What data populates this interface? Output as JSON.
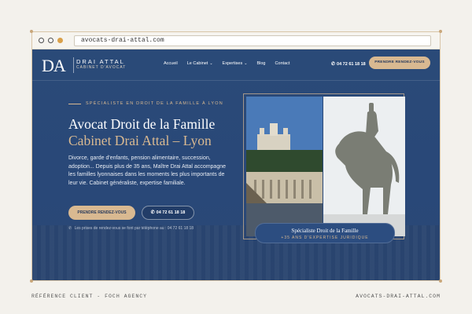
{
  "browser": {
    "url": "avocats-drai-attal.com"
  },
  "nav": {
    "logo_mark": "DA",
    "logo_name": "DRAI ATTAL",
    "logo_sub": "CABINET D'AVOCAT",
    "items": [
      {
        "label": "Accueil",
        "dropdown": false
      },
      {
        "label": "Le Cabinet",
        "dropdown": true
      },
      {
        "label": "Expertises",
        "dropdown": true
      },
      {
        "label": "Blog",
        "dropdown": false
      },
      {
        "label": "Contact",
        "dropdown": false
      }
    ],
    "phone": "04 72 61 18 18",
    "cta": "PRENDRE RENDEZ-VOUS"
  },
  "hero": {
    "kicker": "SPÉCIALISTE EN DROIT DE LA FAMILLE À LYON",
    "title_line1": "Avocat Droit de la Famille",
    "title_line2": "Cabinet Drai Attal – Lyon",
    "description": "Divorce, garde d'enfants, pension alimentaire, succession, adoption... Depuis plus de 35 ans, Maître Drai Attal accompagne les familles lyonnaises dans les moments les plus importants de leur vie. Cabinet généraliste, expertise familiale.",
    "cta_primary": "PRENDRE RENDEZ-VOUS",
    "cta_phone": "04 72 61 18 18",
    "note": "Les prises de rendez-vous se font par téléphone au : 04 72 61 18 18"
  },
  "badge": {
    "title": "Spécialiste Droit de la Famille",
    "subtitle": "+35 ANS D'EXPERTISE JURIDIQUE"
  },
  "captions": {
    "left": "RÉFÉRENCE CLIENT - FOCH AGENCY",
    "right": "AVOCATS-DRAI-ATTAL.COM"
  },
  "colors": {
    "navy": "#2a4a78",
    "gold": "#d9b991",
    "page_bg": "#f3f1ec"
  },
  "icons": [
    "phone-icon",
    "chevron-down-icon",
    "browser-dot-icon"
  ]
}
